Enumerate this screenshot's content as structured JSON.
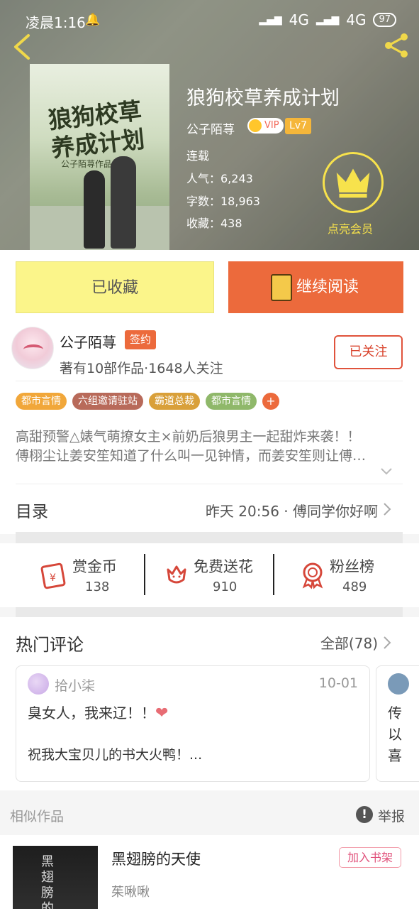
{
  "status_bar": {
    "time": "凌晨1:16",
    "network1": "4G",
    "network2": "4G",
    "battery": "97"
  },
  "book": {
    "title": "狼狗校草养成计划",
    "author": "公子陌荨",
    "vip_label": "VIP",
    "level": "Lv7",
    "status": "连载",
    "popularity": "人气：6,243",
    "word_count": "字数：18,963",
    "favorites": "收藏：438",
    "cover_title": "狼狗校草养成计划",
    "cover_author": "公子陌荨作品"
  },
  "member": {
    "label": "点亮会员",
    "accent": "#f7e24c"
  },
  "actions": {
    "collected_label": "已收藏",
    "read_label": "继续阅读",
    "read_color": "#ec6a3c",
    "collected_color": "#fbf58a"
  },
  "author_info": {
    "name": "公子陌荨",
    "sign_badge": "签约",
    "stats": "著有10部作品·1648人关注",
    "follow_label": "已关注"
  },
  "tags": [
    {
      "label": "都市言情",
      "color": "#f1a73a"
    },
    {
      "label": "六组邀请驻站",
      "color": "#b86a5a"
    },
    {
      "label": "霸道总裁",
      "color": "#d9a03a"
    },
    {
      "label": "都市言情",
      "color": "#8fb86a"
    }
  ],
  "tags_more": "+",
  "description": {
    "line1": "高甜预警△婊气萌撩女主×前奶后狼男主一起甜炸来袭！！",
    "line2": "傅栩尘让姜安笙知道了什么叫一见钟情，而姜安笙则让傅…"
  },
  "toc": {
    "label": "目录",
    "latest": "昨天 20:56 · 傅同学你好啊"
  },
  "stats": [
    {
      "label": "赏金币",
      "value": "138",
      "icon": "red-envelope-icon"
    },
    {
      "label": "免费送花",
      "value": "910",
      "icon": "flower-icon"
    },
    {
      "label": "粉丝榜",
      "value": "489",
      "icon": "medal-icon"
    }
  ],
  "comments": {
    "label": "热门评论",
    "all_label": "全部(78)",
    "items": [
      {
        "user": "拾小柒",
        "date": "10-01",
        "text1": "臭女人，我来辽！！",
        "text2": "祝我大宝贝儿的书大火鸭！..."
      }
    ],
    "partial": {
      "l1": "传",
      "l2": "以",
      "l3": "喜"
    }
  },
  "similar": {
    "label": "相似作品",
    "report_label": "举报",
    "item": {
      "title": "黑翅膀的天使",
      "author": "茱啾啾",
      "add_label": "加入书架",
      "cover_text": "黑翅膀的"
    }
  }
}
